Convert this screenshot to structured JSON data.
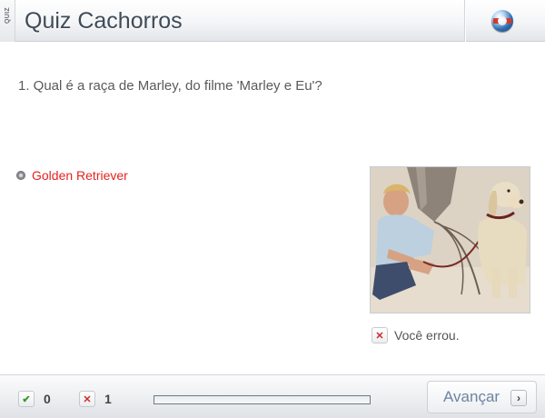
{
  "header": {
    "tag": "QUIZ",
    "title": "Quiz Cachorros",
    "logo_icon": "globo-logo-icon"
  },
  "question": {
    "text": "1. Qual é a raça de Marley, do filme 'Marley e Eu'?"
  },
  "answer": {
    "label": "Golden Retriever",
    "color": "#e4231f"
  },
  "feedback": {
    "icon": "wrong-x-icon",
    "text": "Você errou."
  },
  "footer": {
    "correct_icon": "check-icon",
    "correct_count": "0",
    "wrong_icon": "wrong-x-icon",
    "wrong_count": "1",
    "progress": 0,
    "next_label": "Avançar",
    "next_icon": "chevron-right-icon"
  }
}
